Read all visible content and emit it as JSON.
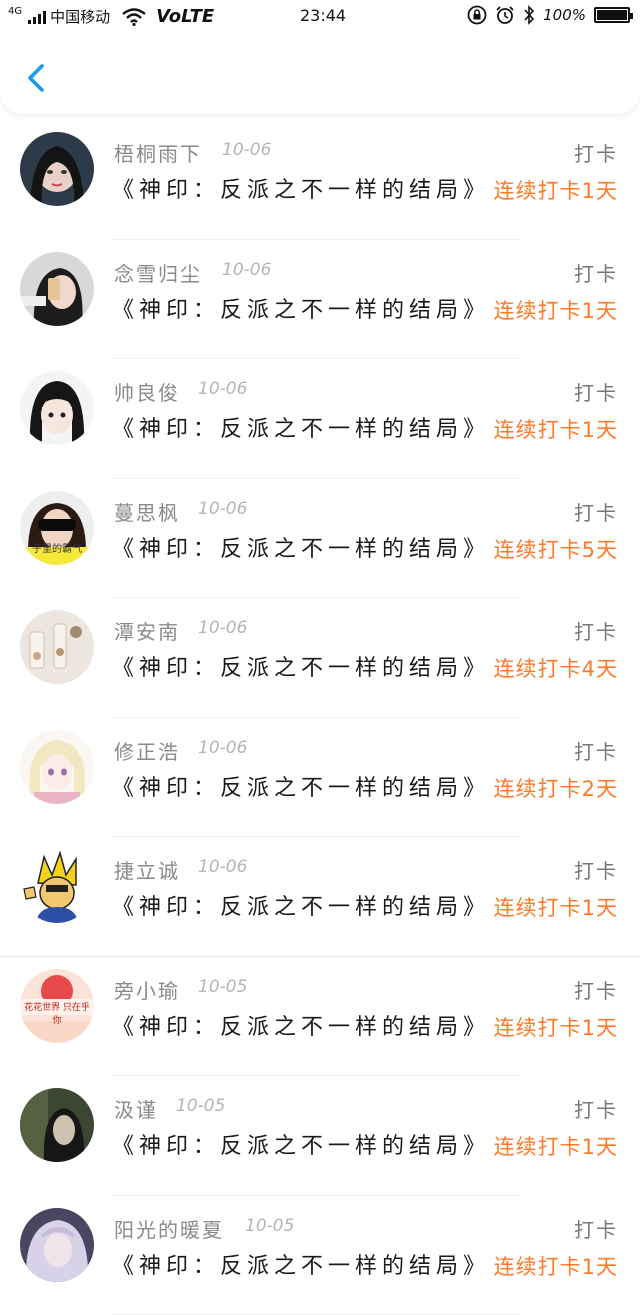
{
  "status_bar": {
    "network_type": "4G",
    "carrier": "中国移动",
    "volte": "VoLTE",
    "time": "23:44",
    "battery": "100%"
  },
  "nav": {
    "back_icon": "chevron-left-icon"
  },
  "colors": {
    "accent": "#1a9bf0",
    "streak": "#ff7a28"
  },
  "entries": [
    {
      "name": "梧桐雨下",
      "date": "10-06",
      "action": "打卡",
      "book": "《神印：反派之不一样的结局》",
      "streak": "连续打卡1天"
    },
    {
      "name": "念雪归尘",
      "date": "10-06",
      "action": "打卡",
      "book": "《神印：反派之不一样的结局》",
      "streak": "连续打卡1天"
    },
    {
      "name": "帅良俊",
      "date": "10-06",
      "action": "打卡",
      "book": "《神印：反派之不一样的结局》",
      "streak": "连续打卡1天"
    },
    {
      "name": "蔓思枫",
      "date": "10-06",
      "action": "打卡",
      "book": "《神印：反派之不一样的结局》",
      "streak": "连续打卡5天",
      "avatar_text": "子里的霸气"
    },
    {
      "name": "潭安南",
      "date": "10-06",
      "action": "打卡",
      "book": "《神印：反派之不一样的结局》",
      "streak": "连续打卡4天"
    },
    {
      "name": "修正浩",
      "date": "10-06",
      "action": "打卡",
      "book": "《神印：反派之不一样的结局》",
      "streak": "连续打卡2天"
    },
    {
      "name": "捷立诚",
      "date": "10-06",
      "action": "打卡",
      "book": "《神印：反派之不一样的结局》",
      "streak": "连续打卡1天"
    },
    {
      "name": "旁小瑜",
      "date": "10-05",
      "action": "打卡",
      "book": "《神印：反派之不一样的结局》",
      "streak": "连续打卡1天",
      "avatar_text": "花花世界 只在乎你"
    },
    {
      "name": "汲谨",
      "date": "10-05",
      "action": "打卡",
      "book": "《神印：反派之不一样的结局》",
      "streak": "连续打卡1天"
    },
    {
      "name": "阳光的暖夏",
      "date": "10-05",
      "action": "打卡",
      "book": "《神印：反派之不一样的结局》",
      "streak": "连续打卡1天"
    }
  ]
}
